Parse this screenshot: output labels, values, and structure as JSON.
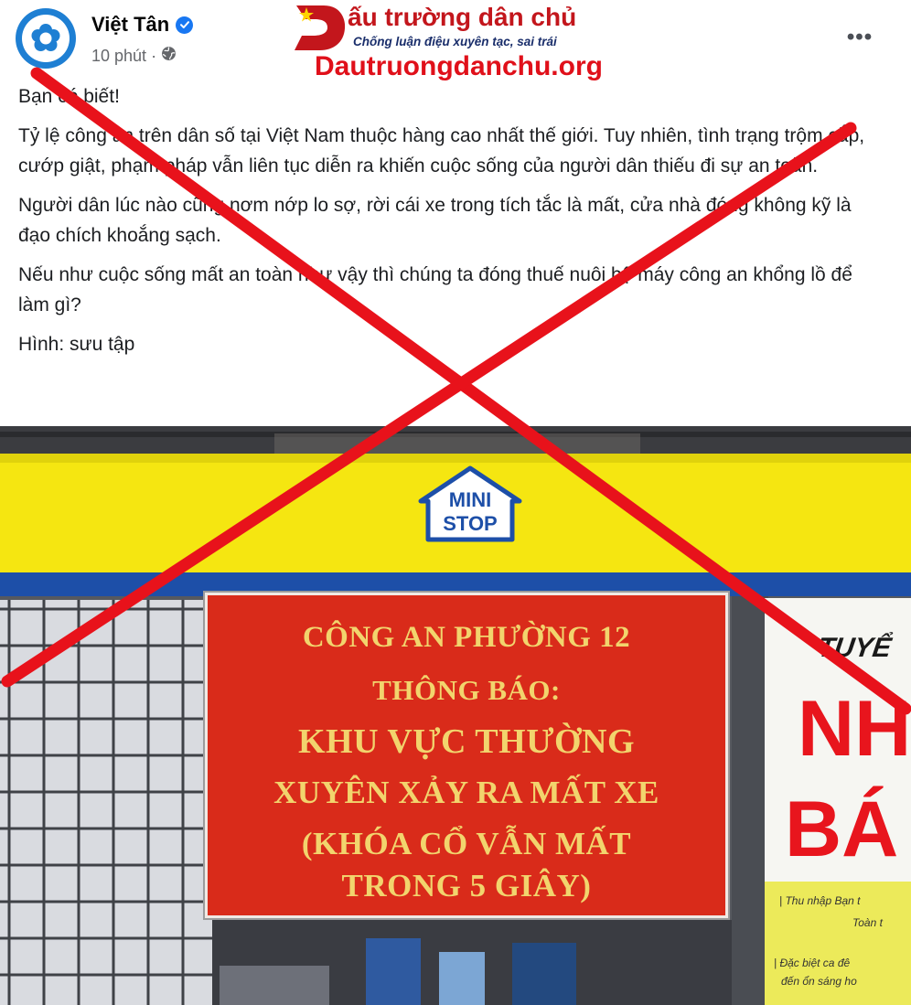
{
  "header": {
    "page_name": "Việt Tân",
    "timestamp": "10 phút",
    "separator": "·",
    "more_label": "•••"
  },
  "watermark": {
    "title": "ấu trường dân chủ",
    "subtitle": "Chống luận điệu xuyên tạc, sai trái",
    "url": "Dautruongdanchu.org"
  },
  "post": {
    "paragraphs": [
      "Bạn có biết!",
      "Tỷ lệ công an trên dân số tại Việt Nam thuộc hàng cao nhất thế giới. Tuy nhiên, tình trạng trộm cắp, cướp giật, phạm pháp vẫn liên tục diễn ra khiến cuộc sống của người dân thiếu đi sự an toàn.",
      "Người dân lúc nào cũng nơm nớp lo sợ, rời cái xe trong tích tắc là mất, cửa nhà đóng không kỹ là đạo chích khoắng sạch.",
      "Nếu như cuộc sống mất an toàn như vậy thì chúng ta đóng thuế nuôi bộ máy công an khổng lồ để làm gì?",
      "Hình: sưu tập"
    ]
  },
  "photo": {
    "store_logo": [
      "MINI",
      "STOP"
    ],
    "notice_lines": [
      "CÔNG AN PHƯỜNG 12",
      "THÔNG BÁO:",
      "KHU VỰC THƯỜNG",
      "XUYÊN XẢY RA MẤT XE",
      "(KHÓA CỔ VẪN MẤT",
      "TRONG 5 GIÂY)"
    ],
    "poster": {
      "top_text": "TUYỂ",
      "big_line1": "NH",
      "big_line2": "BÁ",
      "small_line1": "| Thu nhập Bạn t",
      "small_line2": "Toàn t",
      "small_line3": "| Đặc biệt ca đê",
      "small_line4": "đến ổn sáng ho"
    }
  },
  "colors": {
    "x_overlay": "#e8121b",
    "brand_blue": "#1877f2",
    "notice_red": "#d92b1a",
    "notice_text": "#f2d46d",
    "store_yellow": "#f5e611"
  },
  "icons": {
    "avatar": "vietan-flower-logo",
    "verified": "verified-badge-icon",
    "audience": "globe-icon",
    "more": "more-options-icon"
  }
}
